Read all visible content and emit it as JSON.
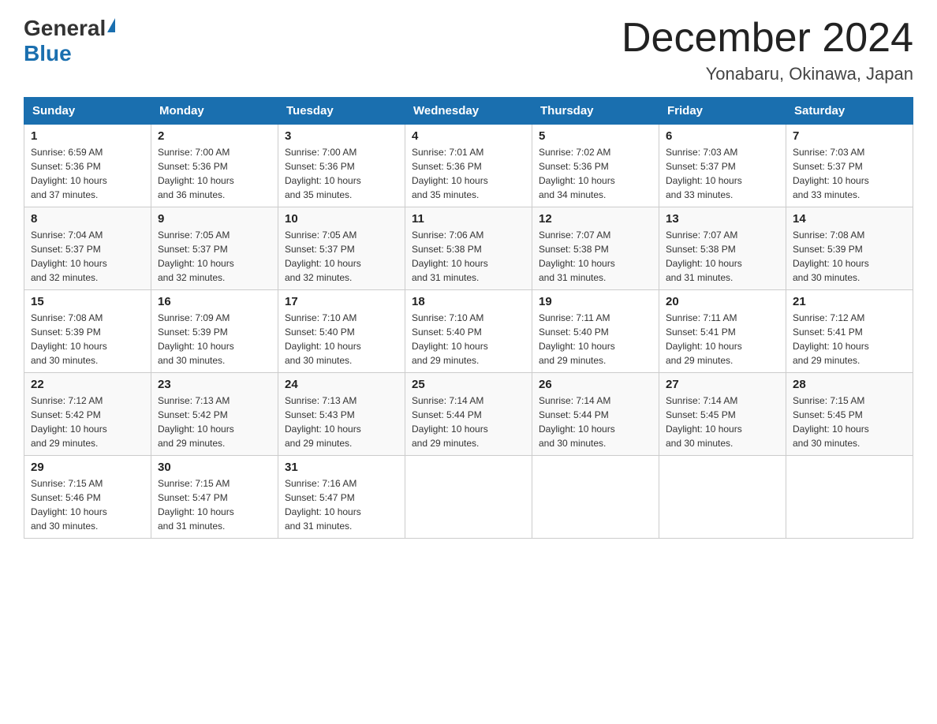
{
  "logo": {
    "text_general": "General",
    "text_blue": "Blue"
  },
  "header": {
    "month": "December 2024",
    "location": "Yonabaru, Okinawa, Japan"
  },
  "weekdays": [
    "Sunday",
    "Monday",
    "Tuesday",
    "Wednesday",
    "Thursday",
    "Friday",
    "Saturday"
  ],
  "weeks": [
    [
      {
        "day": "1",
        "sunrise": "6:59 AM",
        "sunset": "5:36 PM",
        "daylight": "10 hours and 37 minutes."
      },
      {
        "day": "2",
        "sunrise": "7:00 AM",
        "sunset": "5:36 PM",
        "daylight": "10 hours and 36 minutes."
      },
      {
        "day": "3",
        "sunrise": "7:00 AM",
        "sunset": "5:36 PM",
        "daylight": "10 hours and 35 minutes."
      },
      {
        "day": "4",
        "sunrise": "7:01 AM",
        "sunset": "5:36 PM",
        "daylight": "10 hours and 35 minutes."
      },
      {
        "day": "5",
        "sunrise": "7:02 AM",
        "sunset": "5:36 PM",
        "daylight": "10 hours and 34 minutes."
      },
      {
        "day": "6",
        "sunrise": "7:03 AM",
        "sunset": "5:37 PM",
        "daylight": "10 hours and 33 minutes."
      },
      {
        "day": "7",
        "sunrise": "7:03 AM",
        "sunset": "5:37 PM",
        "daylight": "10 hours and 33 minutes."
      }
    ],
    [
      {
        "day": "8",
        "sunrise": "7:04 AM",
        "sunset": "5:37 PM",
        "daylight": "10 hours and 32 minutes."
      },
      {
        "day": "9",
        "sunrise": "7:05 AM",
        "sunset": "5:37 PM",
        "daylight": "10 hours and 32 minutes."
      },
      {
        "day": "10",
        "sunrise": "7:05 AM",
        "sunset": "5:37 PM",
        "daylight": "10 hours and 32 minutes."
      },
      {
        "day": "11",
        "sunrise": "7:06 AM",
        "sunset": "5:38 PM",
        "daylight": "10 hours and 31 minutes."
      },
      {
        "day": "12",
        "sunrise": "7:07 AM",
        "sunset": "5:38 PM",
        "daylight": "10 hours and 31 minutes."
      },
      {
        "day": "13",
        "sunrise": "7:07 AM",
        "sunset": "5:38 PM",
        "daylight": "10 hours and 31 minutes."
      },
      {
        "day": "14",
        "sunrise": "7:08 AM",
        "sunset": "5:39 PM",
        "daylight": "10 hours and 30 minutes."
      }
    ],
    [
      {
        "day": "15",
        "sunrise": "7:08 AM",
        "sunset": "5:39 PM",
        "daylight": "10 hours and 30 minutes."
      },
      {
        "day": "16",
        "sunrise": "7:09 AM",
        "sunset": "5:39 PM",
        "daylight": "10 hours and 30 minutes."
      },
      {
        "day": "17",
        "sunrise": "7:10 AM",
        "sunset": "5:40 PM",
        "daylight": "10 hours and 30 minutes."
      },
      {
        "day": "18",
        "sunrise": "7:10 AM",
        "sunset": "5:40 PM",
        "daylight": "10 hours and 29 minutes."
      },
      {
        "day": "19",
        "sunrise": "7:11 AM",
        "sunset": "5:40 PM",
        "daylight": "10 hours and 29 minutes."
      },
      {
        "day": "20",
        "sunrise": "7:11 AM",
        "sunset": "5:41 PM",
        "daylight": "10 hours and 29 minutes."
      },
      {
        "day": "21",
        "sunrise": "7:12 AM",
        "sunset": "5:41 PM",
        "daylight": "10 hours and 29 minutes."
      }
    ],
    [
      {
        "day": "22",
        "sunrise": "7:12 AM",
        "sunset": "5:42 PM",
        "daylight": "10 hours and 29 minutes."
      },
      {
        "day": "23",
        "sunrise": "7:13 AM",
        "sunset": "5:42 PM",
        "daylight": "10 hours and 29 minutes."
      },
      {
        "day": "24",
        "sunrise": "7:13 AM",
        "sunset": "5:43 PM",
        "daylight": "10 hours and 29 minutes."
      },
      {
        "day": "25",
        "sunrise": "7:14 AM",
        "sunset": "5:44 PM",
        "daylight": "10 hours and 29 minutes."
      },
      {
        "day": "26",
        "sunrise": "7:14 AM",
        "sunset": "5:44 PM",
        "daylight": "10 hours and 30 minutes."
      },
      {
        "day": "27",
        "sunrise": "7:14 AM",
        "sunset": "5:45 PM",
        "daylight": "10 hours and 30 minutes."
      },
      {
        "day": "28",
        "sunrise": "7:15 AM",
        "sunset": "5:45 PM",
        "daylight": "10 hours and 30 minutes."
      }
    ],
    [
      {
        "day": "29",
        "sunrise": "7:15 AM",
        "sunset": "5:46 PM",
        "daylight": "10 hours and 30 minutes."
      },
      {
        "day": "30",
        "sunrise": "7:15 AM",
        "sunset": "5:47 PM",
        "daylight": "10 hours and 31 minutes."
      },
      {
        "day": "31",
        "sunrise": "7:16 AM",
        "sunset": "5:47 PM",
        "daylight": "10 hours and 31 minutes."
      },
      null,
      null,
      null,
      null
    ]
  ],
  "labels": {
    "sunrise": "Sunrise:",
    "sunset": "Sunset:",
    "daylight": "Daylight:"
  },
  "colors": {
    "header_bg": "#1a6faf",
    "header_text": "#ffffff",
    "border": "#cccccc"
  }
}
